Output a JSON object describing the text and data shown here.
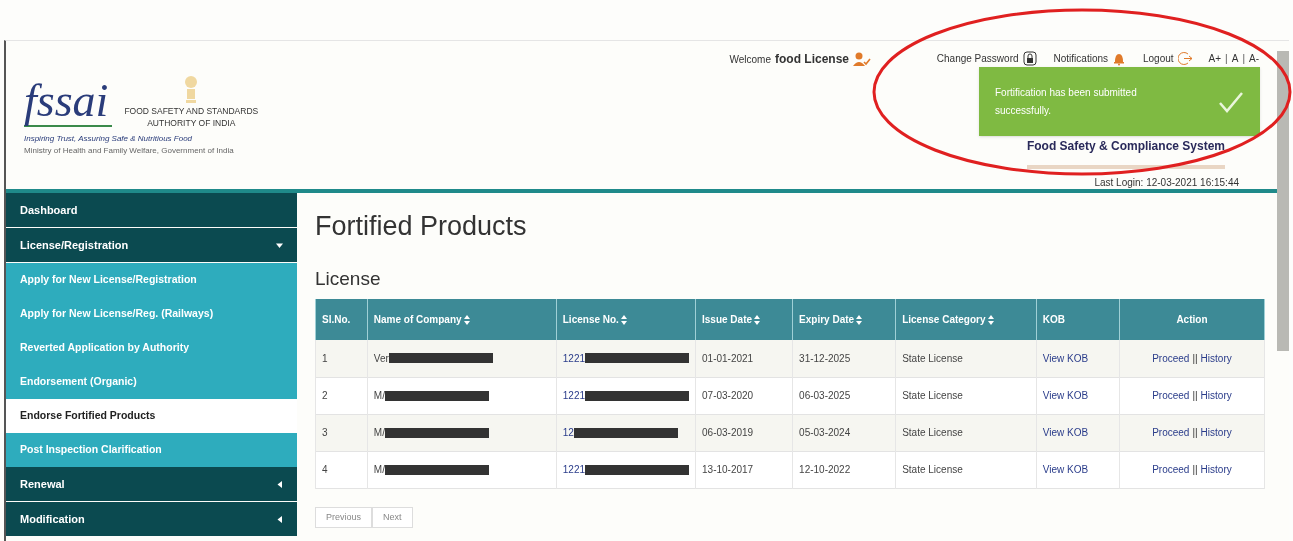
{
  "header": {
    "logo": "fssai",
    "org_name": [
      "FOOD SAFETY AND STANDARDS",
      "AUTHORITY OF INDIA"
    ],
    "tagline": "Inspiring Trust, Assuring Safe & Nutritious Food",
    "ministry": "Ministry of Health and Family Welfare, Government of India",
    "welcome": "Welcome",
    "user": "food License",
    "links": [
      {
        "kind": "password",
        "label": "Change Password"
      },
      {
        "kind": "notifications",
        "label": "Notifications"
      },
      {
        "kind": "logout",
        "label": "Logout"
      }
    ],
    "font_sizes": [
      {
        "kind": "link",
        "label": "A+"
      },
      {
        "kind": "separator",
        "label": "|"
      },
      {
        "kind": "link",
        "label": "A"
      },
      {
        "kind": "separator",
        "label": "|"
      },
      {
        "kind": "link",
        "label": "A-"
      }
    ],
    "system_title": "Food Safety & Compliance System",
    "last_login": "Last Login: 12-03-2021 16:15:44"
  },
  "toast": {
    "message": "Fortification has been submitted successfully."
  },
  "sidebar": {
    "items": [
      {
        "label": "Dashboard"
      },
      {
        "label": "License/Registration",
        "expanded": true,
        "children": [
          {
            "label": "Apply for New License/Registration",
            "selected": false
          },
          {
            "label": "Apply for New License/Reg. (Railways)",
            "selected": false
          },
          {
            "label": "Reverted Application by Authority",
            "selected": false
          },
          {
            "label": "Endorsement (Organic)",
            "selected": false
          },
          {
            "label": "Endorse Fortified Products",
            "selected": true
          },
          {
            "label": "Post Inspection Clarification",
            "selected": false
          }
        ]
      },
      {
        "label": "Renewal",
        "expanded": false
      },
      {
        "label": "Modification",
        "expanded": false
      }
    ]
  },
  "page_title": "Fortified Products",
  "section_title": "License",
  "table": {
    "columns": [
      {
        "label": "Sl.No.",
        "sortable": false
      },
      {
        "label": "Name of Company",
        "sortable": true
      },
      {
        "label": "License No.",
        "sortable": true
      },
      {
        "label": "Issue Date",
        "sortable": true
      },
      {
        "label": "Expiry Date",
        "sortable": true
      },
      {
        "label": "License Category",
        "sortable": true
      },
      {
        "label": "KOB",
        "sortable": false
      },
      {
        "label": "Action",
        "sortable": false
      }
    ],
    "rows": [
      {
        "sl": "1",
        "company": "Ver",
        "license_no": "1221",
        "issue": "01-01-2021",
        "expiry": "31-12-2025",
        "category": "State License",
        "kob": "View KOB",
        "actions": [
          {
            "kind": "link",
            "label": "Proceed"
          },
          {
            "kind": "separator",
            "label": "||"
          },
          {
            "kind": "link",
            "label": "History"
          }
        ]
      },
      {
        "sl": "2",
        "company": "M/",
        "license_no": "1221",
        "issue": "07-03-2020",
        "expiry": "06-03-2025",
        "category": "State License",
        "kob": "View KOB",
        "actions": [
          {
            "kind": "link",
            "label": "Proceed"
          },
          {
            "kind": "separator",
            "label": "||"
          },
          {
            "kind": "link",
            "label": "History"
          }
        ]
      },
      {
        "sl": "3",
        "company": "M/",
        "license_no": "12",
        "issue": "06-03-2019",
        "expiry": "05-03-2024",
        "category": "State License",
        "kob": "View KOB",
        "actions": [
          {
            "kind": "link",
            "label": "Proceed"
          },
          {
            "kind": "separator",
            "label": "||"
          },
          {
            "kind": "link",
            "label": "History"
          }
        ]
      },
      {
        "sl": "4",
        "company": "M/",
        "license_no": "1221",
        "issue": "13-10-2017",
        "expiry": "12-10-2022",
        "category": "State License",
        "kob": "View KOB",
        "actions": [
          {
            "kind": "link",
            "label": "Proceed"
          },
          {
            "kind": "separator",
            "label": "||"
          },
          {
            "kind": "link",
            "label": "History"
          }
        ]
      }
    ]
  },
  "pagination": [
    "Previous",
    "Next"
  ]
}
